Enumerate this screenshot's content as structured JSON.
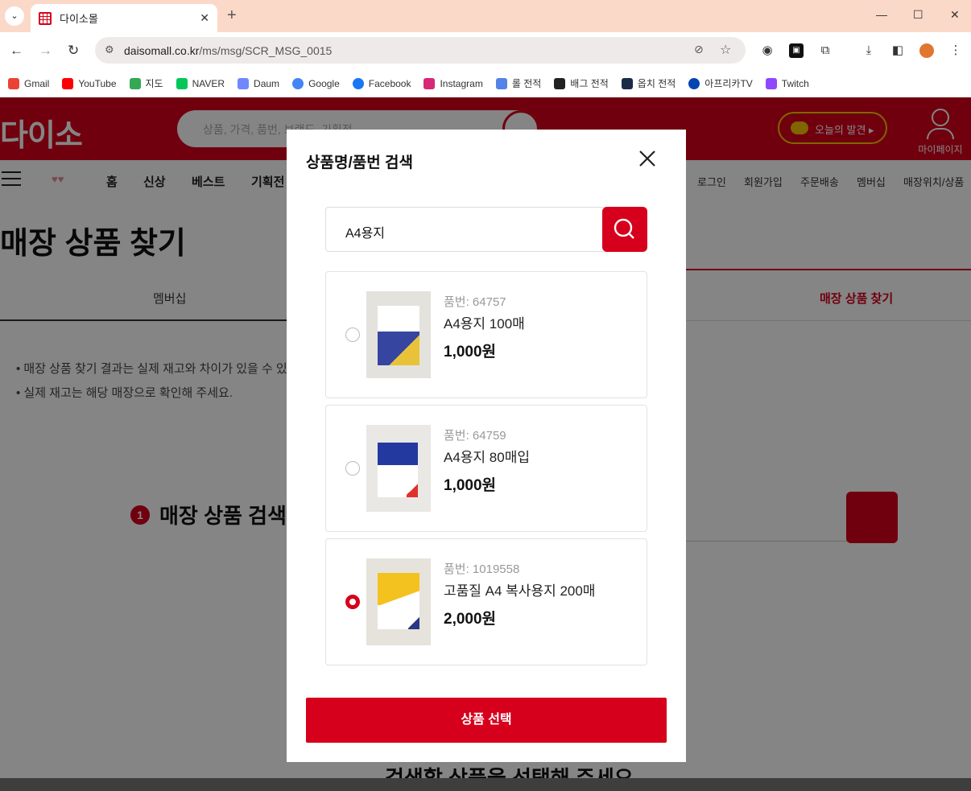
{
  "browser": {
    "tab_title": "다이소몰",
    "url_host": "daisomall.co.kr",
    "url_path": "/ms/msg/SCR_MSG_0015",
    "bookmarks": [
      "Gmail",
      "YouTube",
      "지도",
      "NAVER",
      "Daum",
      "Google",
      "Facebook",
      "Instagram",
      "롤 전적",
      "배그 전적",
      "옵치 전적",
      "아프리카TV",
      "Twitch"
    ]
  },
  "site": {
    "logo": "다이소",
    "search_placeholder": "상품, 가격, 품번, 브랜드, 기획전",
    "discover_label": "오늘의 발견",
    "mypage_label": "마이페이지",
    "nav": [
      "홈",
      "신상",
      "베스트",
      "기획전"
    ],
    "util": [
      "로그인",
      "회원가입",
      "주문배송",
      "멤버십",
      "매장위치/상품"
    ],
    "page_title": "매장 상품 찾기",
    "tabs": [
      "멤버십",
      "매장 상품 찾기"
    ],
    "notes": [
      "• 매장 상품 찾기 결과는 실제 재고와 차이가 있을 수 있",
      "• 실제 재고는 해당 매장으로 확인해 주세요."
    ],
    "step_num": "1",
    "step_label": "매장 상품 검색",
    "bottom_text": "검색할 상품을 선택해 주세요"
  },
  "modal": {
    "title": "상품명/품번 검색",
    "search_value": "A4용지",
    "products": [
      {
        "code": "품번: 64757",
        "name": "A4용지 100매",
        "price": "1,000원",
        "selected": false
      },
      {
        "code": "품번: 64759",
        "name": "A4용지 80매입",
        "price": "1,000원",
        "selected": false
      },
      {
        "code": "품번: 1019558",
        "name": "고품질 A4 복사용지 200매",
        "price": "2,000원",
        "selected": true
      }
    ],
    "select_button": "상품 선택"
  },
  "colors": {
    "brand": "#d6001c",
    "tabstrip": "#fbd9c9"
  }
}
